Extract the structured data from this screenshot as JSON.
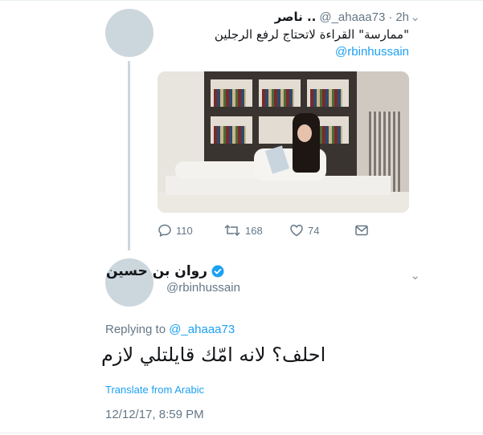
{
  "tweet1": {
    "display_name": "ناصر ..",
    "handle": "@_ahaaa73",
    "separator": "·",
    "time": "2h",
    "text": "\"ممارسة\" القراءة لاتحتاج لرفع الرجلين",
    "mention": "@rbinhussain",
    "actions": {
      "replies": "110",
      "retweets": "168",
      "likes": "74"
    }
  },
  "tweet2": {
    "display_name": "روان بن حسين",
    "handle": "@rbinhussain",
    "replying_prefix": "Replying to",
    "replying_to": "@_ahaaa73",
    "text": "احلف؟ لانه امّك قايلتلي لازم",
    "translate_label": "Translate from Arabic",
    "timestamp": "12/12/17, 8:59 PM"
  },
  "icons": {
    "chevron": "chevron-down-icon",
    "reply": "reply-icon",
    "retweet": "retweet-icon",
    "like": "heart-icon",
    "dm": "envelope-icon",
    "verified": "verified-badge-icon"
  },
  "colors": {
    "accent": "#1da1f2",
    "secondary_text": "#657786",
    "avatar_placeholder": "#ccd6dd"
  }
}
